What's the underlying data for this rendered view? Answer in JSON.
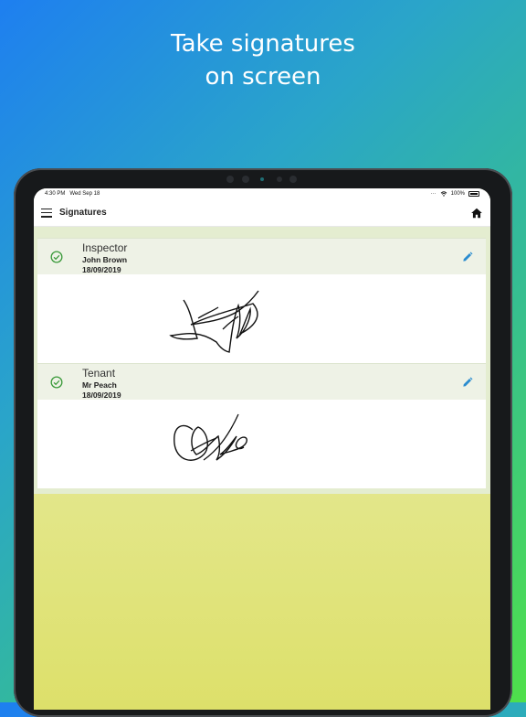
{
  "promo": {
    "line1": "Take signatures",
    "line2": "on screen"
  },
  "status_bar": {
    "time": "4:30 PM",
    "date": "Wed Sep 18",
    "battery": "100%"
  },
  "navbar": {
    "title": "Signatures"
  },
  "signatures": [
    {
      "role": "Inspector",
      "name": "John Brown",
      "date": "18/09/2019",
      "signed": true
    },
    {
      "role": "Tenant",
      "name": "Mr Peach",
      "date": "18/09/2019",
      "signed": true
    }
  ],
  "colors": {
    "check": "#3a9a3a",
    "edit": "#2a8ccf"
  },
  "icons": [
    "menu-icon",
    "home-icon",
    "check-circle-icon",
    "pencil-icon",
    "wifi-icon",
    "battery-icon"
  ]
}
